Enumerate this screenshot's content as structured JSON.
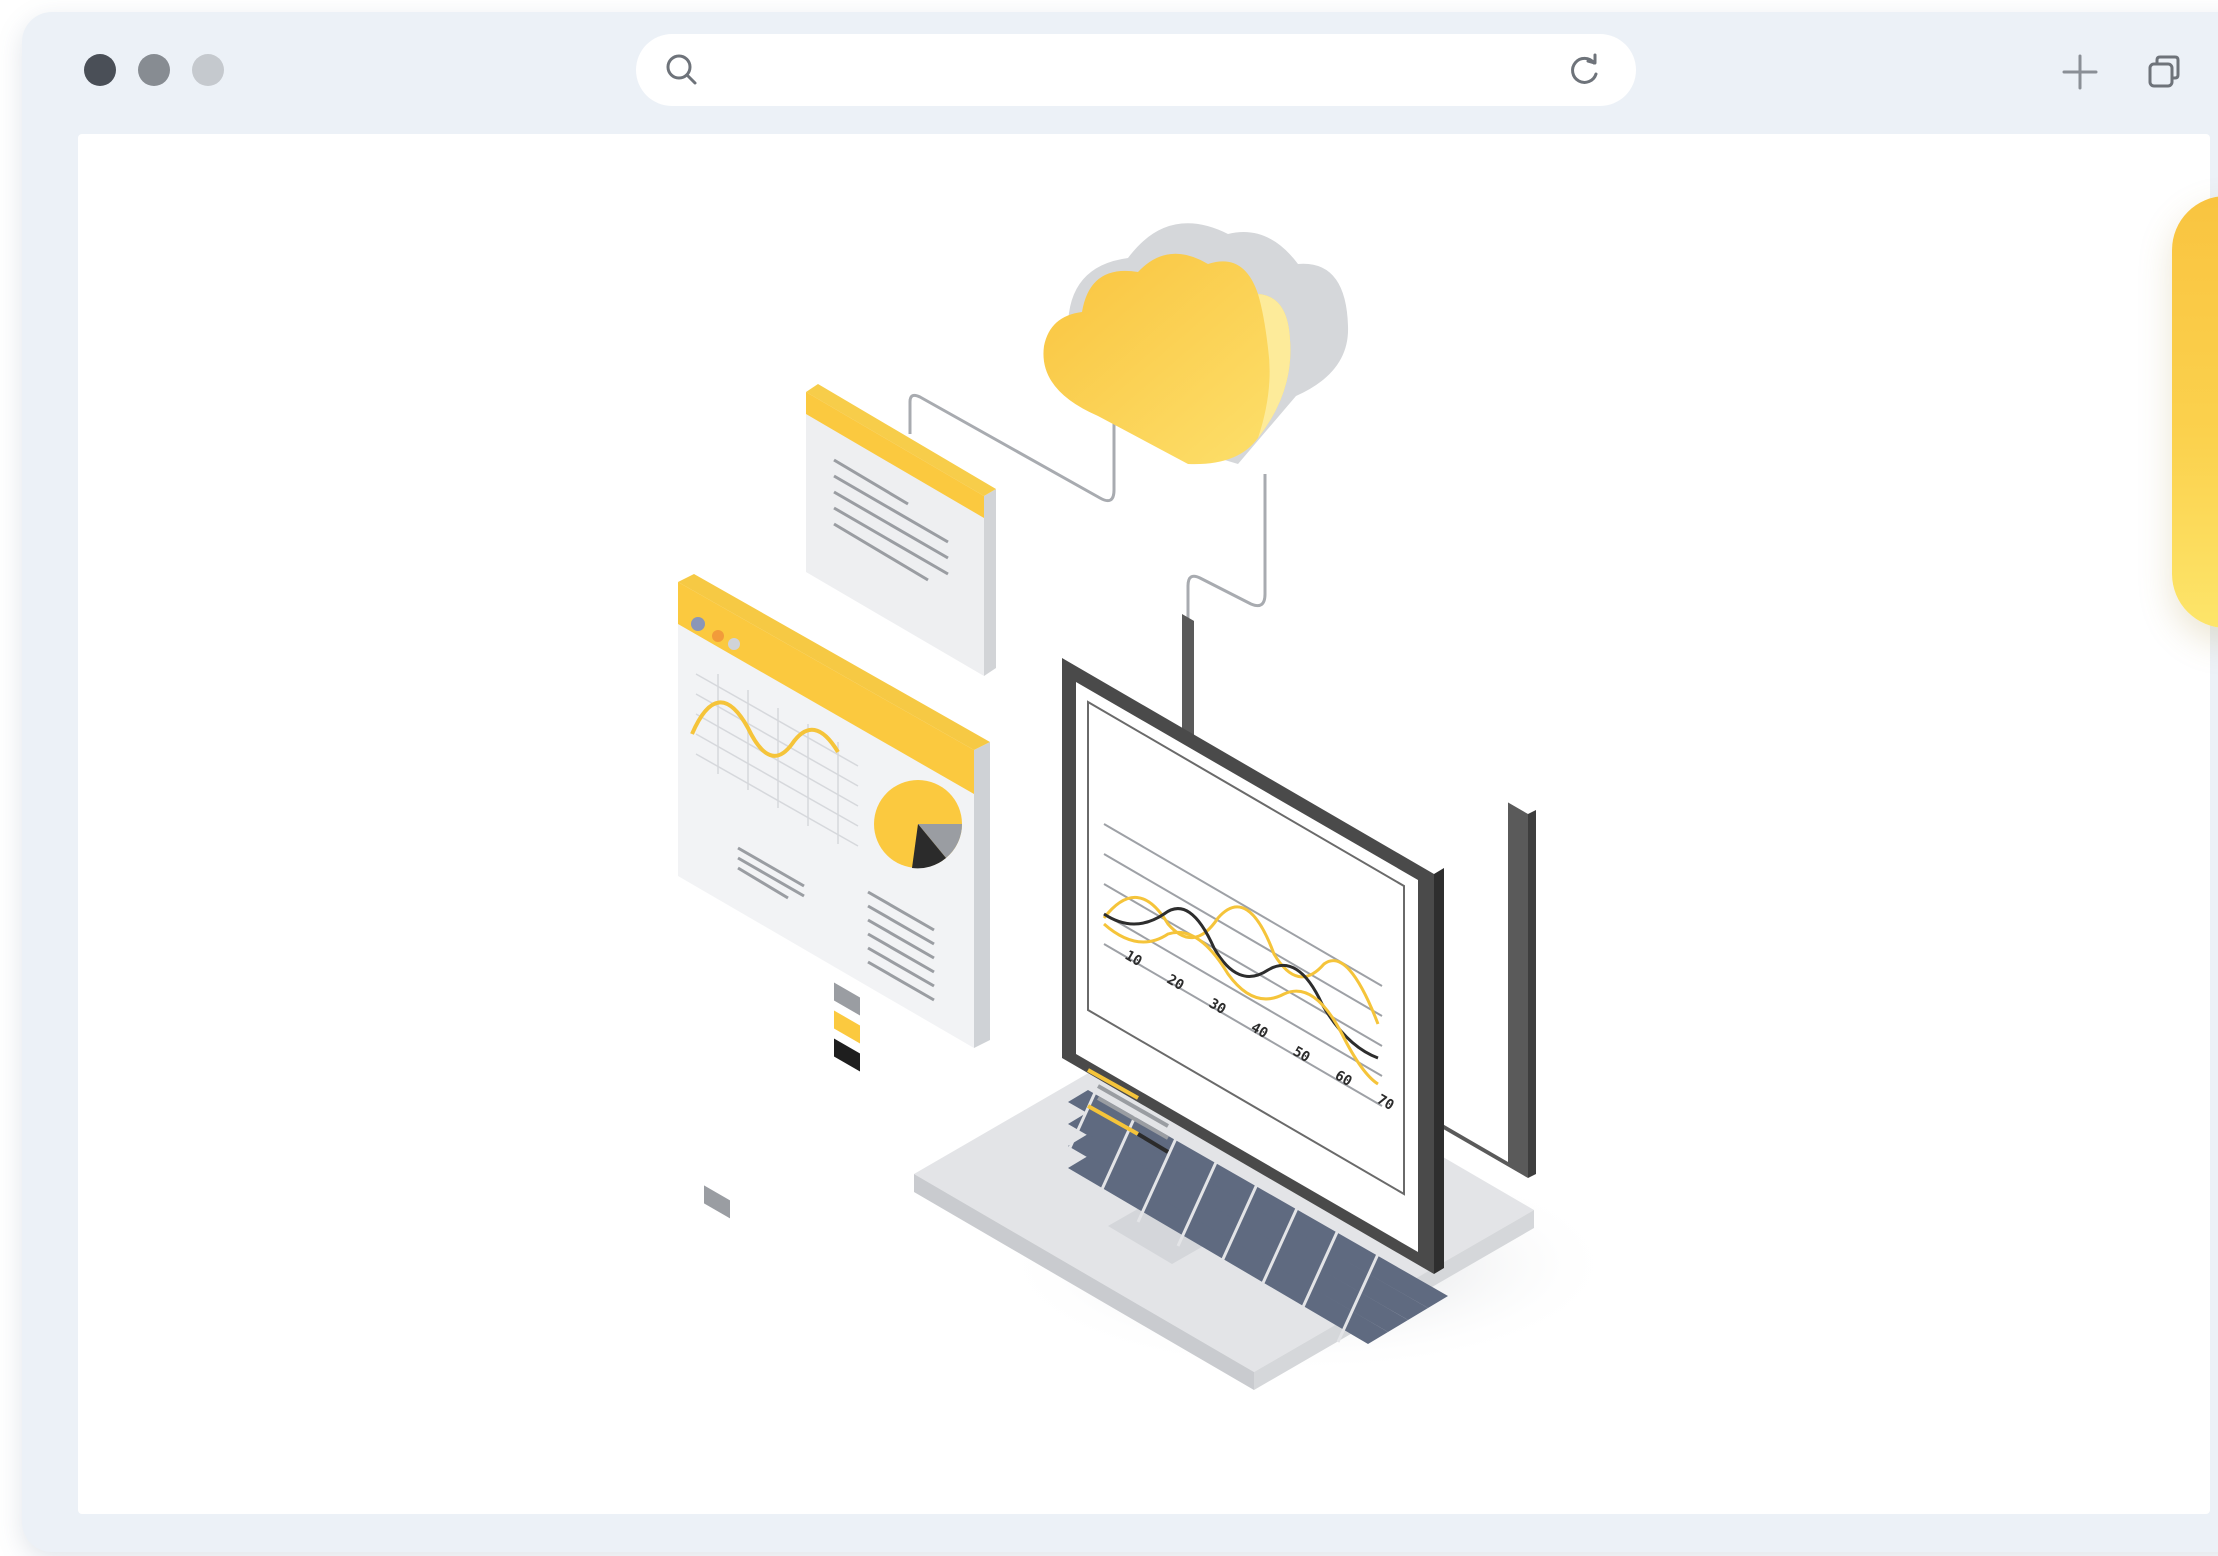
{
  "window": {
    "traffic_lights": [
      {
        "name": "close",
        "color": "#4a4f57"
      },
      {
        "name": "minimize",
        "color": "#878c92"
      },
      {
        "name": "zoom",
        "color": "#c5c9ce"
      }
    ],
    "background_color": "#ecf1f7"
  },
  "address_bar": {
    "value": "",
    "placeholder": "",
    "search_icon": "search-icon",
    "reload_icon": "reload-icon"
  },
  "toolbar": {
    "new_tab_icon": "plus-icon",
    "tabs_icon": "tabs-overview-icon"
  },
  "illustration": {
    "accent_color": "#fbc93f",
    "dark_color": "#4a4a4a",
    "laptop_chart": {
      "x_tick_labels": [
        "10",
        "20",
        "30",
        "40",
        "50",
        "60",
        "70"
      ]
    }
  }
}
